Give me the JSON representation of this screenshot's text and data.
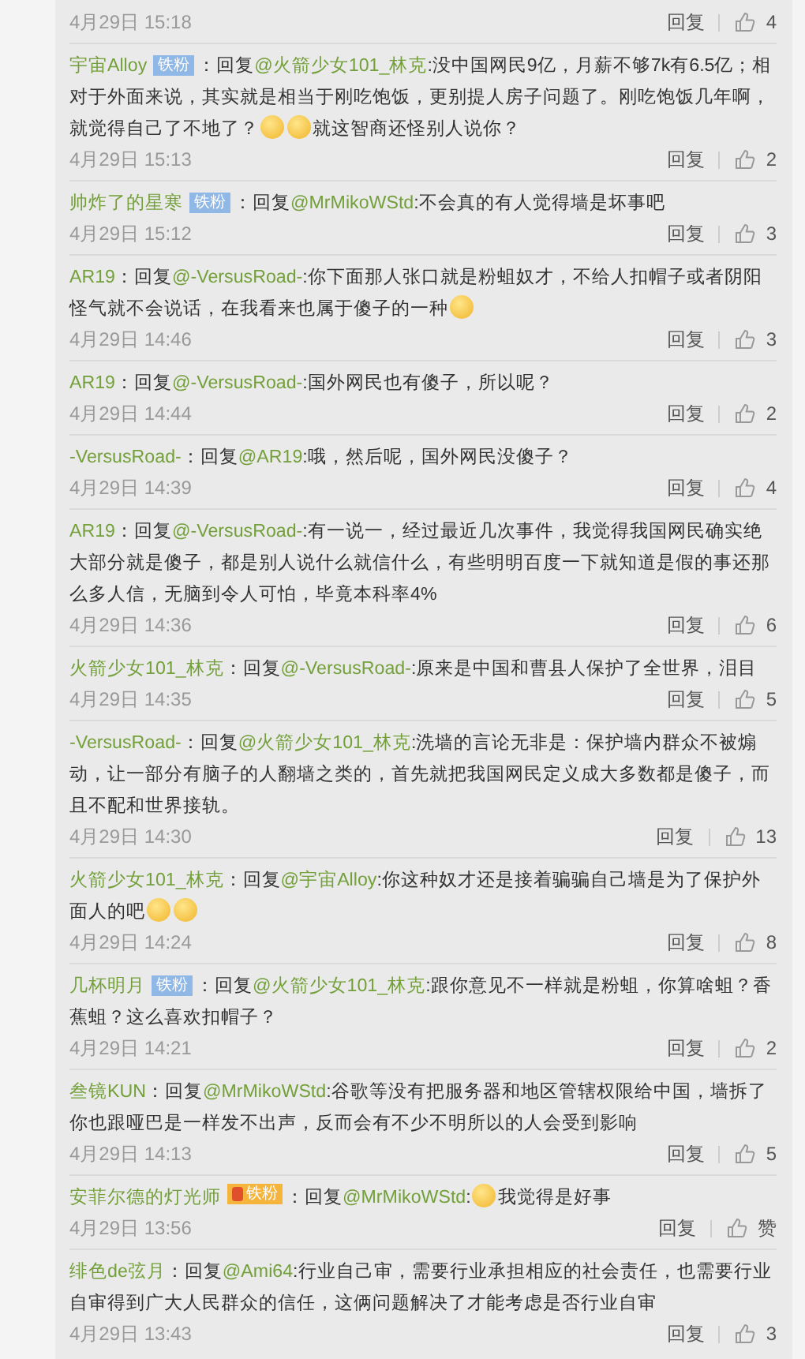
{
  "comments": [
    {
      "date": "4月29日 15:18",
      "reply": "回复",
      "likes": "4"
    },
    {
      "user": "宇宙Alloy",
      "badge": {
        "kind": "blue",
        "label": "铁粉"
      },
      "prefix": "：回复",
      "mention": "@火箭少女101_林克",
      "segments": [
        {
          "kind": "text",
          "text": ":没中国网民9亿，月薪不够7k有6.5亿；相对于外面来说，其实就是相当于刚吃饱饭，更别提人房子问题了。刚吃饱饭几年啊，就觉得自己了不地了？"
        },
        {
          "kind": "emoji"
        },
        {
          "kind": "emoji"
        },
        {
          "kind": "text",
          "text": "就这智商还怪别人说你？"
        }
      ],
      "date": "4月29日 15:13",
      "reply": "回复",
      "likes": "2"
    },
    {
      "user": "帅炸了的星寒",
      "badge": {
        "kind": "blue",
        "label": "铁粉"
      },
      "prefix": "：回复",
      "mention": "@MrMikoWStd",
      "segments": [
        {
          "kind": "text",
          "text": ":不会真的有人觉得墙是坏事吧"
        }
      ],
      "date": "4月29日 15:12",
      "reply": "回复",
      "likes": "3"
    },
    {
      "user": "AR19",
      "prefix": "：回复",
      "mention": "@-VersusRoad-",
      "segments": [
        {
          "kind": "text",
          "text": ":你下面那人张口就是粉蛆奴才，不给人扣帽子或者阴阳怪气就不会说话，在我看来也属于傻子的一种"
        },
        {
          "kind": "emoji"
        }
      ],
      "date": "4月29日 14:46",
      "reply": "回复",
      "likes": "3"
    },
    {
      "user": "AR19",
      "prefix": "：回复",
      "mention": "@-VersusRoad-",
      "segments": [
        {
          "kind": "text",
          "text": ":国外网民也有傻子，所以呢？"
        }
      ],
      "date": "4月29日 14:44",
      "reply": "回复",
      "likes": "2"
    },
    {
      "user": "-VersusRoad-",
      "prefix": "：回复",
      "mention": "@AR19",
      "segments": [
        {
          "kind": "text",
          "text": ":哦，然后呢，国外网民没傻子？"
        }
      ],
      "date": "4月29日 14:39",
      "reply": "回复",
      "likes": "4"
    },
    {
      "user": "AR19",
      "prefix": "：回复",
      "mention": "@-VersusRoad-",
      "segments": [
        {
          "kind": "text",
          "text": ":有一说一，经过最近几次事件，我觉得我国网民确实绝大部分就是傻子，都是别人说什么就信什么，有些明明百度一下就知道是假的事还那么多人信，无脑到令人可怕，毕竟本科率4%"
        }
      ],
      "date": "4月29日 14:36",
      "reply": "回复",
      "likes": "6"
    },
    {
      "user": "火箭少女101_林克",
      "prefix": "：回复",
      "mention": "@-VersusRoad-",
      "segments": [
        {
          "kind": "text",
          "text": ":原来是中国和曹县人保护了全世界，泪目"
        }
      ],
      "date": "4月29日 14:35",
      "reply": "回复",
      "likes": "5"
    },
    {
      "user": "-VersusRoad-",
      "prefix": "：回复",
      "mention": "@火箭少女101_林克",
      "segments": [
        {
          "kind": "text",
          "text": ":洗墙的言论无非是：保护墙内群众不被煽动，让一部分有脑子的人翻墙之类的，首先就把我国网民定义成大多数都是傻子，而且不配和世界接轨。"
        }
      ],
      "date": "4月29日 14:30",
      "reply": "回复",
      "likes": "13"
    },
    {
      "user": "火箭少女101_林克",
      "prefix": "：回复",
      "mention": "@宇宙Alloy",
      "segments": [
        {
          "kind": "text",
          "text": ":你这种奴才还是接着骗骗自己墙是为了保护外面人的吧"
        },
        {
          "kind": "emoji"
        },
        {
          "kind": "emoji"
        }
      ],
      "date": "4月29日 14:24",
      "reply": "回复",
      "likes": "8"
    },
    {
      "user": "几杯明月",
      "badge": {
        "kind": "blue",
        "label": "铁粉"
      },
      "prefix": "：回复",
      "mention": "@火箭少女101_林克",
      "segments": [
        {
          "kind": "text",
          "text": ":跟你意见不一样就是粉蛆，你算啥蛆？香蕉蛆？这么喜欢扣帽子？"
        }
      ],
      "date": "4月29日 14:21",
      "reply": "回复",
      "likes": "2"
    },
    {
      "user": "叁镜KUN",
      "prefix": "：回复",
      "mention": "@MrMikoWStd",
      "segments": [
        {
          "kind": "text",
          "text": ":谷歌等没有把服务器和地区管辖权限给中国，墙拆了你也跟哑巴是一样发不出声，反而会有不少不明所以的人会受到影响"
        }
      ],
      "date": "4月29日 14:13",
      "reply": "回复",
      "likes": "5"
    },
    {
      "user": "安菲尔德的灯光师",
      "badge": {
        "kind": "orange",
        "label": "铁粉"
      },
      "prefix": "：回复",
      "mention": "@MrMikoWStd",
      "segments": [
        {
          "kind": "text",
          "text": ":"
        },
        {
          "kind": "emoji"
        },
        {
          "kind": "text",
          "text": "我觉得是好事"
        }
      ],
      "date": "4月29日 13:56",
      "reply": "回复",
      "likes": "赞"
    },
    {
      "user": "绯色de弦月",
      "prefix": "：回复",
      "mention": "@Ami64",
      "segments": [
        {
          "kind": "text",
          "text": ":行业自己审，需要行业承担相应的社会责任，也需要行业自审得到广大人民群众的信任，这俩问题解决了才能考虑是否行业自审"
        }
      ],
      "date": "4月29日 13:43",
      "reply": "回复",
      "likes": "3"
    }
  ]
}
